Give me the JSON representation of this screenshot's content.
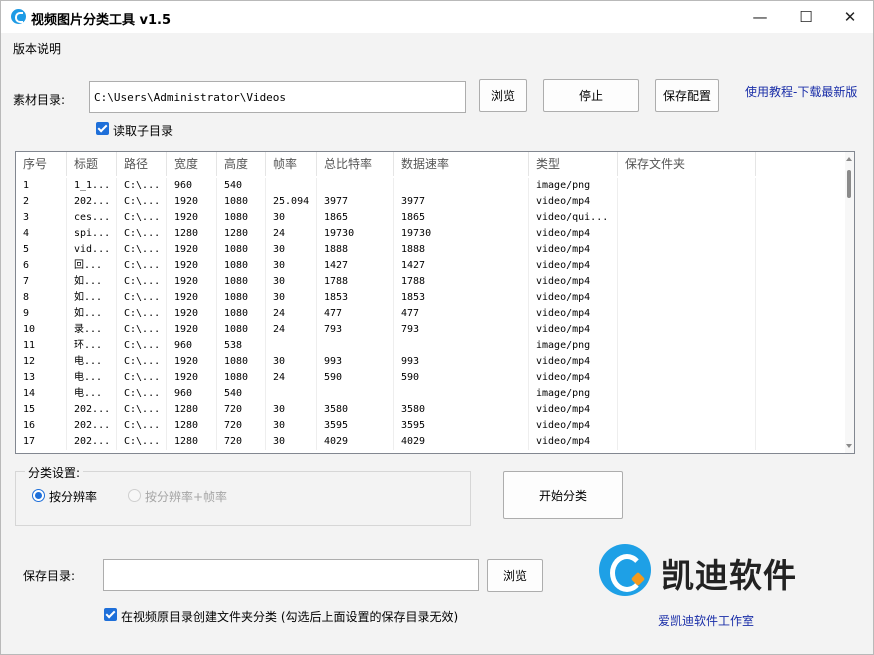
{
  "window": {
    "title": "视频图片分类工具 v1.5",
    "minimize_glyph": "—",
    "maximize_glyph": "☐",
    "close_glyph": "✕"
  },
  "menu": {
    "version_notes": "版本说明"
  },
  "source": {
    "label": "素材目录:",
    "path": "C:\\Users\\Administrator\\Videos",
    "browse_label": "浏览",
    "stop_label": "停止",
    "save_config_label": "保存配置",
    "tutorial_link": "使用教程-下载最新版",
    "read_subdirs_label": "读取子目录",
    "read_subdirs_checked": true
  },
  "table": {
    "columns": [
      "序号",
      "标题",
      "路径",
      "宽度",
      "高度",
      "帧率",
      "总比特率",
      "数据速率",
      "类型",
      "保存文件夹"
    ],
    "rows": [
      [
        "1",
        "1_1...",
        "C:\\...",
        "960",
        "540",
        "",
        "",
        "",
        "image/png",
        ""
      ],
      [
        "2",
        "202...",
        "C:\\...",
        "1920",
        "1080",
        "25.094",
        "3977",
        "3977",
        "video/mp4",
        ""
      ],
      [
        "3",
        "ces...",
        "C:\\...",
        "1920",
        "1080",
        "30",
        "1865",
        "1865",
        "video/qui...",
        ""
      ],
      [
        "4",
        "spi...",
        "C:\\...",
        "1280",
        "1280",
        "24",
        "19730",
        "19730",
        "video/mp4",
        ""
      ],
      [
        "5",
        "vid...",
        "C:\\...",
        "1920",
        "1080",
        "30",
        "1888",
        "1888",
        "video/mp4",
        ""
      ],
      [
        "6",
        "回...",
        "C:\\...",
        "1920",
        "1080",
        "30",
        "1427",
        "1427",
        "video/mp4",
        ""
      ],
      [
        "7",
        "如...",
        "C:\\...",
        "1920",
        "1080",
        "30",
        "1788",
        "1788",
        "video/mp4",
        ""
      ],
      [
        "8",
        "如...",
        "C:\\...",
        "1920",
        "1080",
        "30",
        "1853",
        "1853",
        "video/mp4",
        ""
      ],
      [
        "9",
        "如...",
        "C:\\...",
        "1920",
        "1080",
        "24",
        "477",
        "477",
        "video/mp4",
        ""
      ],
      [
        "10",
        "录...",
        "C:\\...",
        "1920",
        "1080",
        "24",
        "793",
        "793",
        "video/mp4",
        ""
      ],
      [
        "11",
        "环...",
        "C:\\...",
        "960",
        "538",
        "",
        "",
        "",
        "image/png",
        ""
      ],
      [
        "12",
        "电...",
        "C:\\...",
        "1920",
        "1080",
        "30",
        "993",
        "993",
        "video/mp4",
        ""
      ],
      [
        "13",
        "电...",
        "C:\\...",
        "1920",
        "1080",
        "24",
        "590",
        "590",
        "video/mp4",
        ""
      ],
      [
        "14",
        "电...",
        "C:\\...",
        "960",
        "540",
        "",
        "",
        "",
        "image/png",
        ""
      ],
      [
        "15",
        "202...",
        "C:\\...",
        "1280",
        "720",
        "30",
        "3580",
        "3580",
        "video/mp4",
        ""
      ],
      [
        "16",
        "202...",
        "C:\\...",
        "1280",
        "720",
        "30",
        "3595",
        "3595",
        "video/mp4",
        ""
      ],
      [
        "17",
        "202...",
        "C:\\...",
        "1280",
        "720",
        "30",
        "4029",
        "4029",
        "video/mp4",
        ""
      ]
    ]
  },
  "classify": {
    "group_title": "分类设置:",
    "by_resolution_label": "按分辨率",
    "by_resolution_fps_label": "按分辨率+帧率",
    "start_label": "开始分类"
  },
  "save": {
    "label": "保存目录:",
    "path": "",
    "browse_label": "浏览",
    "create_in_source_label": "在视频原目录创建文件夹分类 (勾选后上面设置的保存目录无效)",
    "create_in_source_checked": true
  },
  "brand": {
    "name": "凯迪软件",
    "studio_link": "爱凯迪软件工作室",
    "logo_blue": "#1ea0e6",
    "logo_orange": "#f39a1e"
  }
}
